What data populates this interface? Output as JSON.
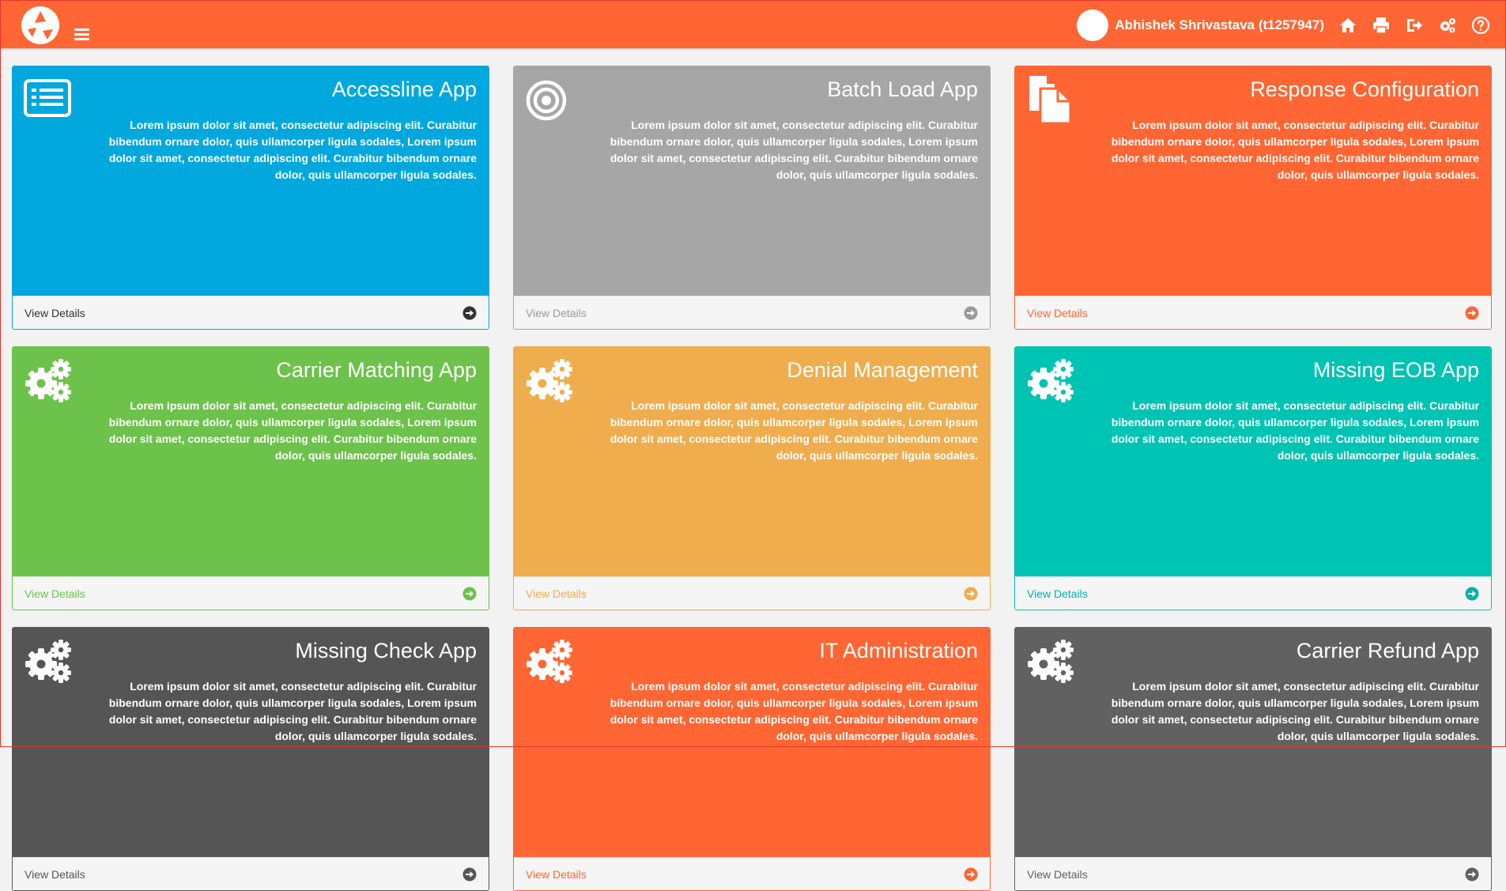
{
  "header": {
    "user_name": "Abhishek Shrivastava (t1257947)",
    "icons": [
      "home-icon",
      "print-icon",
      "logout-icon",
      "settings-icon",
      "help-icon"
    ]
  },
  "colors": {
    "header": "#ff6633",
    "blue": "#00a8de",
    "gray": "#a6a6a6",
    "orange": "#ff6633",
    "green": "#6cc24a",
    "amber": "#efad4e",
    "teal": "#00c4b3",
    "dark": "#555555"
  },
  "cards": [
    {
      "title": "Accessline App",
      "icon": "list-icon",
      "color": "#00a8de",
      "desc": "Lorem ipsum dolor sit amet, consectetur adipiscing elit. Curabitur bibendum ornare dolor, quis ullamcorper ligula sodales, Lorem ipsum dolor sit amet, consectetur adipiscing elit. Curabitur bibendum ornare dolor, quis ullamcorper ligula sodales.",
      "link": "View Details",
      "link_color": "#333333"
    },
    {
      "title": "Batch Load App",
      "icon": "target-icon",
      "color": "#a6a6a6",
      "desc": "Lorem ipsum dolor sit amet, consectetur adipiscing elit. Curabitur bibendum ornare dolor, quis ullamcorper ligula sodales, Lorem ipsum dolor sit amet, consectetur adipiscing elit. Curabitur bibendum ornare dolor, quis ullamcorper ligula sodales.",
      "link": "View Details",
      "link_color": "#9a9a9a"
    },
    {
      "title": "Response Configuration",
      "icon": "documents-icon",
      "color": "#ff6633",
      "desc": "Lorem ipsum dolor sit amet, consectetur adipiscing elit. Curabitur bibendum ornare dolor, quis ullamcorper ligula sodales, Lorem ipsum dolor sit amet, consectetur adipiscing elit. Curabitur bibendum ornare dolor, quis ullamcorper ligula sodales.",
      "link": "View Details",
      "link_color": "#ff6633"
    },
    {
      "title": "Carrier Matching App",
      "icon": "gears-icon",
      "color": "#6cc24a",
      "desc": "Lorem ipsum dolor sit amet, consectetur adipiscing elit. Curabitur bibendum ornare dolor, quis ullamcorper ligula sodales, Lorem ipsum dolor sit amet, consectetur adipiscing elit. Curabitur bibendum ornare dolor, quis ullamcorper ligula sodales.",
      "link": "View Details",
      "link_color": "#6cc24a"
    },
    {
      "title": "Denial Management",
      "icon": "gears-icon",
      "color": "#efad4e",
      "desc": "Lorem ipsum dolor sit amet, consectetur adipiscing elit. Curabitur bibendum ornare dolor, quis ullamcorper ligula sodales, Lorem ipsum dolor sit amet, consectetur adipiscing elit. Curabitur bibendum ornare dolor, quis ullamcorper ligula sodales.",
      "link": "View Details",
      "link_color": "#efad4e"
    },
    {
      "title": "Missing EOB App",
      "icon": "gears-icon",
      "color": "#00c4b3",
      "desc": "Lorem ipsum dolor sit amet, consectetur adipiscing elit. Curabitur bibendum ornare dolor, quis ullamcorper ligula sodales, Lorem ipsum dolor sit amet, consectetur adipiscing elit. Curabitur bibendum ornare dolor, quis ullamcorper ligula sodales.",
      "link": "View Details",
      "link_color": "#00b3a4"
    },
    {
      "title": "Missing Check App",
      "icon": "gears-icon",
      "color": "#555555",
      "desc": "Lorem ipsum dolor sit amet, consectetur adipiscing elit. Curabitur bibendum ornare dolor, quis ullamcorper ligula sodales, Lorem ipsum dolor sit amet, consectetur adipiscing elit. Curabitur bibendum ornare dolor, quis ullamcorper ligula sodales.",
      "link": "View Details",
      "link_color": "#555555"
    },
    {
      "title": "IT Administration",
      "icon": "gears-icon",
      "color": "#ff6633",
      "desc": "Lorem ipsum dolor sit amet, consectetur adipiscing elit. Curabitur bibendum ornare dolor, quis ullamcorper ligula sodales, Lorem ipsum dolor sit amet, consectetur adipiscing elit. Curabitur bibendum ornare dolor, quis ullamcorper ligula sodales.",
      "link": "View Details",
      "link_color": "#ff6633"
    },
    {
      "title": "Carrier Refund App",
      "icon": "gears-icon",
      "color": "#616161",
      "desc": "Lorem ipsum dolor sit amet, consectetur adipiscing elit. Curabitur bibendum ornare dolor, quis ullamcorper ligula sodales, Lorem ipsum dolor sit amet, consectetur adipiscing elit. Curabitur bibendum ornare dolor, quis ullamcorper ligula sodales.",
      "link": "View Details",
      "link_color": "#616161"
    }
  ]
}
